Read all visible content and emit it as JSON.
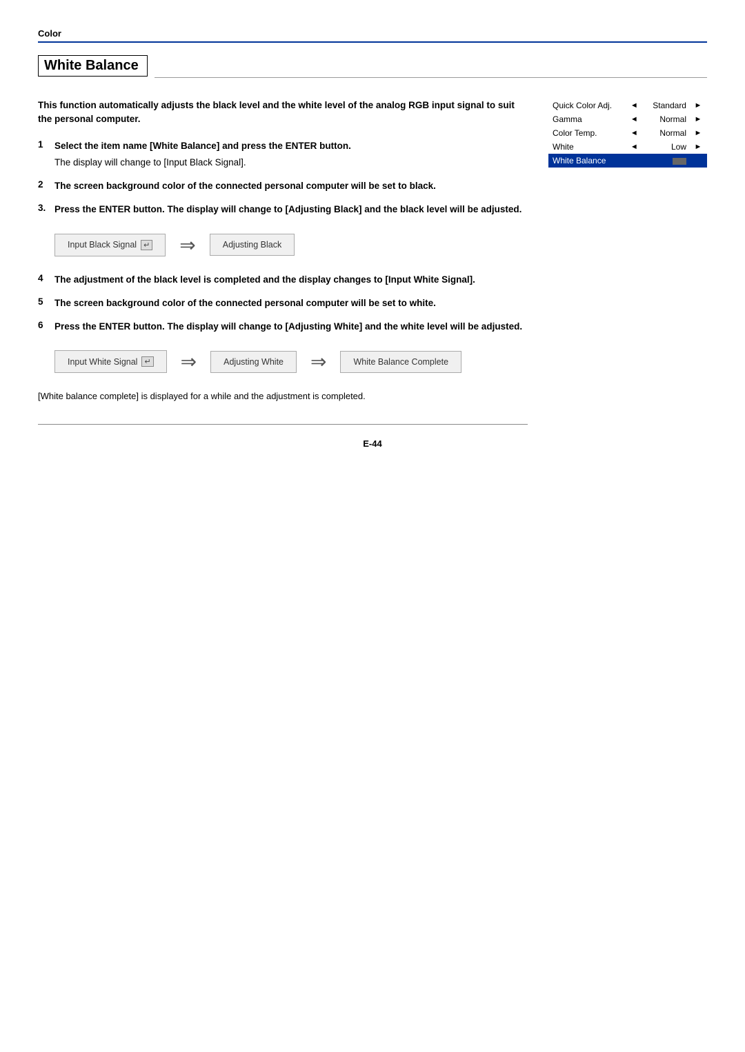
{
  "header": {
    "section_label": "Color"
  },
  "title": "White Balance",
  "intro": "This function automatically adjusts the black level and the white level of the analog RGB input signal to suit the personal computer.",
  "steps": [
    {
      "num": "1",
      "text": "Select the item name [White Balance] and press the ENTER button.",
      "subtext": "The display will change to [Input Black Signal]."
    },
    {
      "num": "2",
      "text": "The screen background color of the connected personal computer will be set to black.",
      "subtext": ""
    },
    {
      "num": "3.",
      "text": "Press the ENTER button. The display will change to [Adjusting Black] and the black level will be adjusted.",
      "subtext": ""
    },
    {
      "num": "4",
      "text": "The adjustment of the black level is completed and the display changes to [Input White Signal].",
      "subtext": ""
    },
    {
      "num": "5",
      "text": "The screen background color of the connected personal computer will be set to white.",
      "subtext": ""
    },
    {
      "num": "6",
      "text": "Press the ENTER button. The display will change to [Adjusting White] and the white level will be adjusted.",
      "subtext": ""
    }
  ],
  "diagram1": {
    "box1": "Input Black Signal",
    "box2": "Adjusting Black"
  },
  "diagram2": {
    "box1": "Input White Signal",
    "box2": "Adjusting White",
    "box3": "White Balance Complete"
  },
  "footer_text": "[White balance complete] is displayed for a while and the adjustment is completed.",
  "menu": {
    "items": [
      {
        "label": "Quick Color Adj.",
        "arrow_left": "◄",
        "value": "Standard",
        "arrow_right": "►",
        "highlight": false
      },
      {
        "label": "Gamma",
        "arrow_left": "◄",
        "value": "Normal",
        "arrow_right": "►",
        "highlight": false
      },
      {
        "label": "Color Temp.",
        "arrow_left": "◄",
        "value": "Normal",
        "arrow_right": "►",
        "highlight": false
      },
      {
        "label": "White",
        "arrow_left": "◄",
        "value": "Low",
        "arrow_right": "►",
        "highlight": false
      },
      {
        "label": "White Balance",
        "arrow_left": "",
        "value": "",
        "arrow_right": "",
        "highlight": true
      }
    ]
  },
  "page_number": "E-44"
}
